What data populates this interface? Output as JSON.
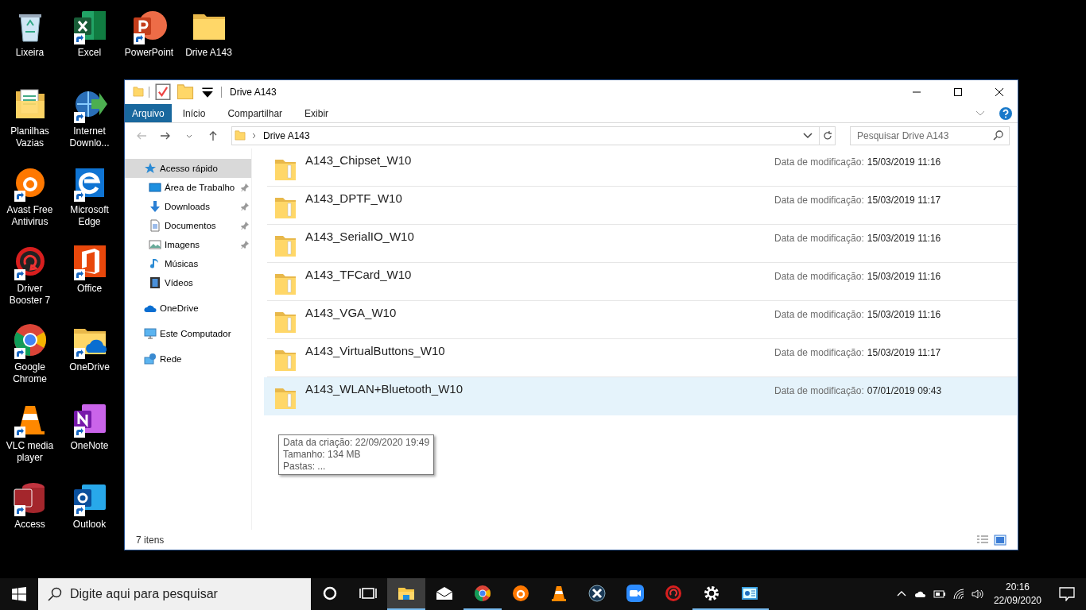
{
  "desktop": {
    "columns": [
      [
        {
          "label": "Lixeira",
          "kind": "recycle",
          "shortcut": false
        },
        {
          "label": "Planilhas Vazias",
          "kind": "docfolder",
          "shortcut": false
        },
        {
          "label": "Avast Free Antivirus",
          "kind": "avast",
          "shortcut": true
        },
        {
          "label": "Driver Booster 7",
          "kind": "booster",
          "shortcut": true
        },
        {
          "label": "Google Chrome",
          "kind": "chrome",
          "shortcut": true
        },
        {
          "label": "VLC media player",
          "kind": "vlc",
          "shortcut": true
        },
        {
          "label": "Access",
          "kind": "access",
          "shortcut": true
        }
      ],
      [
        {
          "label": "Excel",
          "kind": "excel",
          "shortcut": true
        },
        {
          "label": "Internet Downlo...",
          "kind": "idm",
          "shortcut": true
        },
        {
          "label": "Microsoft Edge",
          "kind": "edge",
          "shortcut": true
        },
        {
          "label": "Office",
          "kind": "office",
          "shortcut": true
        },
        {
          "label": "OneDrive",
          "kind": "onedrivefolder",
          "shortcut": true
        },
        {
          "label": "OneNote",
          "kind": "onenote",
          "shortcut": true
        },
        {
          "label": "Outlook",
          "kind": "outlook",
          "shortcut": true
        }
      ],
      [
        {
          "label": "PowerPoint",
          "kind": "powerpoint",
          "shortcut": true
        }
      ],
      [
        {
          "label": "Drive A143",
          "kind": "folder",
          "shortcut": false
        }
      ]
    ]
  },
  "window": {
    "title": "Drive A143",
    "ribbon_tabs": [
      {
        "label": "Arquivo",
        "selected": true
      },
      {
        "label": "Início",
        "selected": false
      },
      {
        "label": "Compartilhar",
        "selected": false
      },
      {
        "label": "Exibir",
        "selected": false
      }
    ],
    "breadcrumb": [
      "Drive A143"
    ],
    "search": {
      "placeholder": "Pesquisar Drive A143"
    },
    "nav": [
      {
        "label": "Acesso rápido",
        "kind": "star",
        "selected": true,
        "children": [
          {
            "label": "Área de Trabalho",
            "kind": "desktop",
            "pinned": true,
            "selected": false
          },
          {
            "label": "Downloads",
            "kind": "download",
            "pinned": true,
            "selected": false
          },
          {
            "label": "Documentos",
            "kind": "document",
            "pinned": true,
            "selected": false
          },
          {
            "label": "Imagens",
            "kind": "image",
            "pinned": true,
            "selected": false
          },
          {
            "label": "Músicas",
            "kind": "music",
            "pinned": false,
            "selected": false
          },
          {
            "label": "Vídeos",
            "kind": "video",
            "pinned": false,
            "selected": false
          }
        ]
      },
      {
        "label": "OneDrive",
        "kind": "cloud",
        "selected": false
      },
      {
        "label": "Este Computador",
        "kind": "computer",
        "selected": false
      },
      {
        "label": "Rede",
        "kind": "network",
        "selected": false
      }
    ],
    "files": [
      {
        "name": "A143_Chipset_W10",
        "date_label": "Data de modificação:",
        "date": "15/03/2019 11:16",
        "selected": false
      },
      {
        "name": "A143_DPTF_W10",
        "date_label": "Data de modificação:",
        "date": "15/03/2019 11:17",
        "selected": false
      },
      {
        "name": "A143_SerialIO_W10",
        "date_label": "Data de modificação:",
        "date": "15/03/2019 11:16",
        "selected": false
      },
      {
        "name": "A143_TFCard_W10",
        "date_label": "Data de modificação:",
        "date": "15/03/2019 11:16",
        "selected": false
      },
      {
        "name": "A143_VGA_W10",
        "date_label": "Data de modificação:",
        "date": "15/03/2019 11:16",
        "selected": false
      },
      {
        "name": "A143_VirtualButtons_W10",
        "date_label": "Data de modificação:",
        "date": "15/03/2019 11:17",
        "selected": false
      },
      {
        "name": "A143_WLAN+Bluetooth_W10",
        "date_label": "Data de modificação:",
        "date": "07/01/2019 09:43",
        "selected": true
      }
    ],
    "tooltip": [
      "Data da criação: 22/09/2020 19:49",
      "Tamanho: 134 MB",
      "Pastas: ..."
    ],
    "status_bar": "7 itens"
  },
  "taskbar": {
    "search_placeholder": "Digite aqui para pesquisar",
    "apps": [
      {
        "kind": "cortana",
        "open": false,
        "active": false
      },
      {
        "kind": "taskview",
        "open": false,
        "active": false
      },
      {
        "kind": "explorer",
        "open": true,
        "active": true
      },
      {
        "kind": "mail",
        "open": false,
        "active": false
      },
      {
        "kind": "chrome",
        "open": true,
        "active": false
      },
      {
        "kind": "avast",
        "open": false,
        "active": false
      },
      {
        "kind": "vlc",
        "open": false,
        "active": false
      },
      {
        "kind": "xbox",
        "open": false,
        "active": false
      },
      {
        "kind": "zoom",
        "open": false,
        "active": false
      },
      {
        "kind": "booster",
        "open": false,
        "active": false
      },
      {
        "kind": "settings",
        "open": true,
        "active": false
      },
      {
        "kind": "control",
        "open": true,
        "active": false
      }
    ],
    "time": "20:16",
    "date": "22/09/2020"
  }
}
